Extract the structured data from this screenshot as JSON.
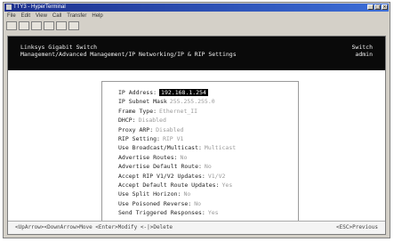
{
  "window": {
    "title": "TTY3 - HyperTerminal"
  },
  "menus": [
    "File",
    "Edit",
    "View",
    "Call",
    "Transfer",
    "Help"
  ],
  "toolbar": [
    "new",
    "open",
    "connect",
    "disconnect",
    "send",
    "properties"
  ],
  "header": {
    "system": "Linksys Gigabit Switch",
    "path": "Management/Advanced Management/IP Networking/IP & RIP Settings",
    "right1": "Switch",
    "right2": "admin"
  },
  "fields": [
    {
      "label": "IP Address:",
      "value": "192.168.1.254",
      "highlight": true
    },
    {
      "label": "IP Subnet Mask",
      "value": "255.255.255.0",
      "highlight": false
    },
    {
      "label": "Frame Type:",
      "value": "Ethernet_II",
      "highlight": false
    },
    {
      "label": "DHCP:",
      "value": "Disabled",
      "highlight": false
    },
    {
      "label": "Proxy ARP:",
      "value": "Disabled",
      "highlight": false
    },
    {
      "label": "RIP Setting:",
      "value": "RIP V1",
      "highlight": false
    },
    {
      "label": "Use Broadcast/Multicast:",
      "value": "Multicast",
      "highlight": false
    },
    {
      "label": "Advertise Routes:",
      "value": "No",
      "highlight": false
    },
    {
      "label": "Advertise Default Route:",
      "value": "No",
      "highlight": false
    },
    {
      "label": "Accept RIP V1/V2 Updates:",
      "value": "V1/V2",
      "highlight": false
    },
    {
      "label": "Accept Default Route Updates:",
      "value": "Yes",
      "highlight": false
    },
    {
      "label": "Use Split Horizon:",
      "value": "No",
      "highlight": false
    },
    {
      "label": "Use Poisoned Reverse:",
      "value": "No",
      "highlight": false
    },
    {
      "label": "Send Triggered Responses:",
      "value": "Yes",
      "highlight": false
    }
  ],
  "status": {
    "left": "<UpArrow><DownArrow>Move <Enter>Modify <-|>Delete",
    "right": "<ESC>Previous"
  }
}
